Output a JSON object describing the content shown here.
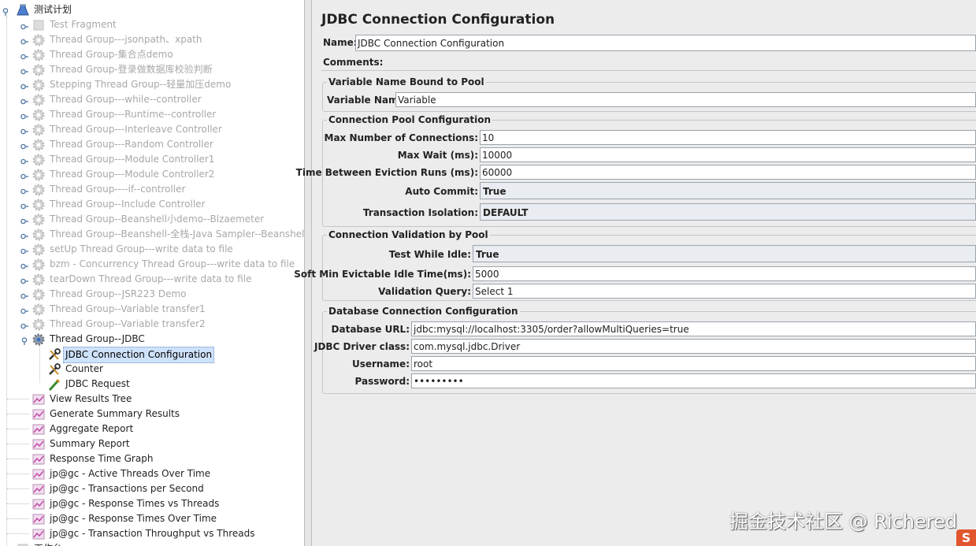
{
  "tree": {
    "root": "测试计划",
    "items": [
      {
        "label": "Test Fragment",
        "enabled": false,
        "icon": "fragment-icon"
      },
      {
        "label": "Thread Group---jsonpath、xpath",
        "enabled": false,
        "icon": "gear-icon"
      },
      {
        "label": "Thread Group-集合点demo",
        "enabled": false,
        "icon": "gear-icon"
      },
      {
        "label": "Thread Group-登录做数据库校验判断",
        "enabled": false,
        "icon": "gear-icon"
      },
      {
        "label": "Stepping Thread Group--轻量加压demo",
        "enabled": false,
        "icon": "gear-icon"
      },
      {
        "label": "Thread Group---while--controller",
        "enabled": false,
        "icon": "gear-icon"
      },
      {
        "label": "Thread Group---Runtime--controller",
        "enabled": false,
        "icon": "gear-icon"
      },
      {
        "label": "Thread Group---Interleave Controller",
        "enabled": false,
        "icon": "gear-icon"
      },
      {
        "label": "Thread Group---Random Controller",
        "enabled": false,
        "icon": "gear-icon"
      },
      {
        "label": "Thread Group---Module Controller1",
        "enabled": false,
        "icon": "gear-icon"
      },
      {
        "label": "Thread Group---Module Controller2",
        "enabled": false,
        "icon": "gear-icon"
      },
      {
        "label": "Thread Group----if--controller",
        "enabled": false,
        "icon": "gear-icon"
      },
      {
        "label": "Thread Group--Include Controller",
        "enabled": false,
        "icon": "gear-icon"
      },
      {
        "label": "Thread Group--Beanshell小demo--Blzaemeter",
        "enabled": false,
        "icon": "gear-icon"
      },
      {
        "label": "Thread Group--Beanshell-全栈-Java Sampler--Beanshell",
        "enabled": false,
        "icon": "gear-icon"
      },
      {
        "label": "setUp Thread Group---write data to file",
        "enabled": false,
        "icon": "gear-icon"
      },
      {
        "label": "bzm - Concurrency Thread Group---write data to file",
        "enabled": false,
        "icon": "gear-icon"
      },
      {
        "label": "tearDown Thread Group---write data to file",
        "enabled": false,
        "icon": "gear-icon"
      },
      {
        "label": "Thread Group--JSR223 Demo",
        "enabled": false,
        "icon": "gear-icon"
      },
      {
        "label": "Thread Group--Variable transfer1",
        "enabled": false,
        "icon": "gear-icon"
      },
      {
        "label": "Thread Group--Variable transfer2",
        "enabled": false,
        "icon": "gear-icon"
      },
      {
        "label": "Thread Group--JDBC",
        "enabled": true,
        "icon": "thread-group-icon",
        "expanded": true
      }
    ],
    "children": [
      {
        "label": "JDBC Connection Configuration",
        "icon": "wrench-icon",
        "selected": true
      },
      {
        "label": "Counter",
        "icon": "wrench-icon"
      },
      {
        "label": "JDBC Request",
        "icon": "pipette-icon"
      }
    ],
    "listeners": [
      "View Results Tree",
      "Generate Summary Results",
      "Aggregate Report",
      "Summary Report",
      "Response Time Graph",
      "jp@gc - Active Threads Over Time",
      "jp@gc - Transactions per Second",
      "jp@gc - Response Times vs Threads",
      "jp@gc - Response Times Over Time",
      "jp@gc - Transaction Throughput vs Threads"
    ],
    "last_partial": "工作台"
  },
  "panel": {
    "title": "JDBC Connection Configuration",
    "name_label": "Name:",
    "name_value": "JDBC Connection Configuration",
    "comments_label": "Comments:",
    "groups": {
      "var_bound": "Variable Name Bound to Pool",
      "pool": "Connection Pool Configuration",
      "validation": "Connection Validation by Pool",
      "database": "Database Connection Configuration"
    },
    "fields": {
      "variable_name": {
        "label": "Variable Name:",
        "value": "Variable"
      },
      "max_connections": {
        "label": "Max Number of Connections:",
        "value": "10"
      },
      "max_wait": {
        "label": "Max Wait (ms):",
        "value": "10000"
      },
      "eviction": {
        "label": "Time Between Eviction Runs (ms):",
        "value": "60000"
      },
      "auto_commit": {
        "label": "Auto Commit:",
        "value": "True"
      },
      "isolation": {
        "label": "Transaction Isolation:",
        "value": "DEFAULT"
      },
      "test_idle": {
        "label": "Test While Idle:",
        "value": "True"
      },
      "soft_min": {
        "label": "Soft Min Evictable Idle Time(ms):",
        "value": "5000"
      },
      "validation_query": {
        "label": "Validation Query:",
        "value": "Select 1"
      },
      "db_url": {
        "label": "Database URL:",
        "value": "jdbc:mysql://localhost:3305/order?allowMultiQueries=true"
      },
      "driver": {
        "label": "JDBC Driver class:",
        "value": "com.mysql.jdbc.Driver"
      },
      "username": {
        "label": "Username:",
        "value": "root"
      },
      "password": {
        "label": "Password:",
        "value": "•••••••••"
      }
    }
  },
  "watermark": "掘金技术社区 @ Richered",
  "corner_logo": "S"
}
